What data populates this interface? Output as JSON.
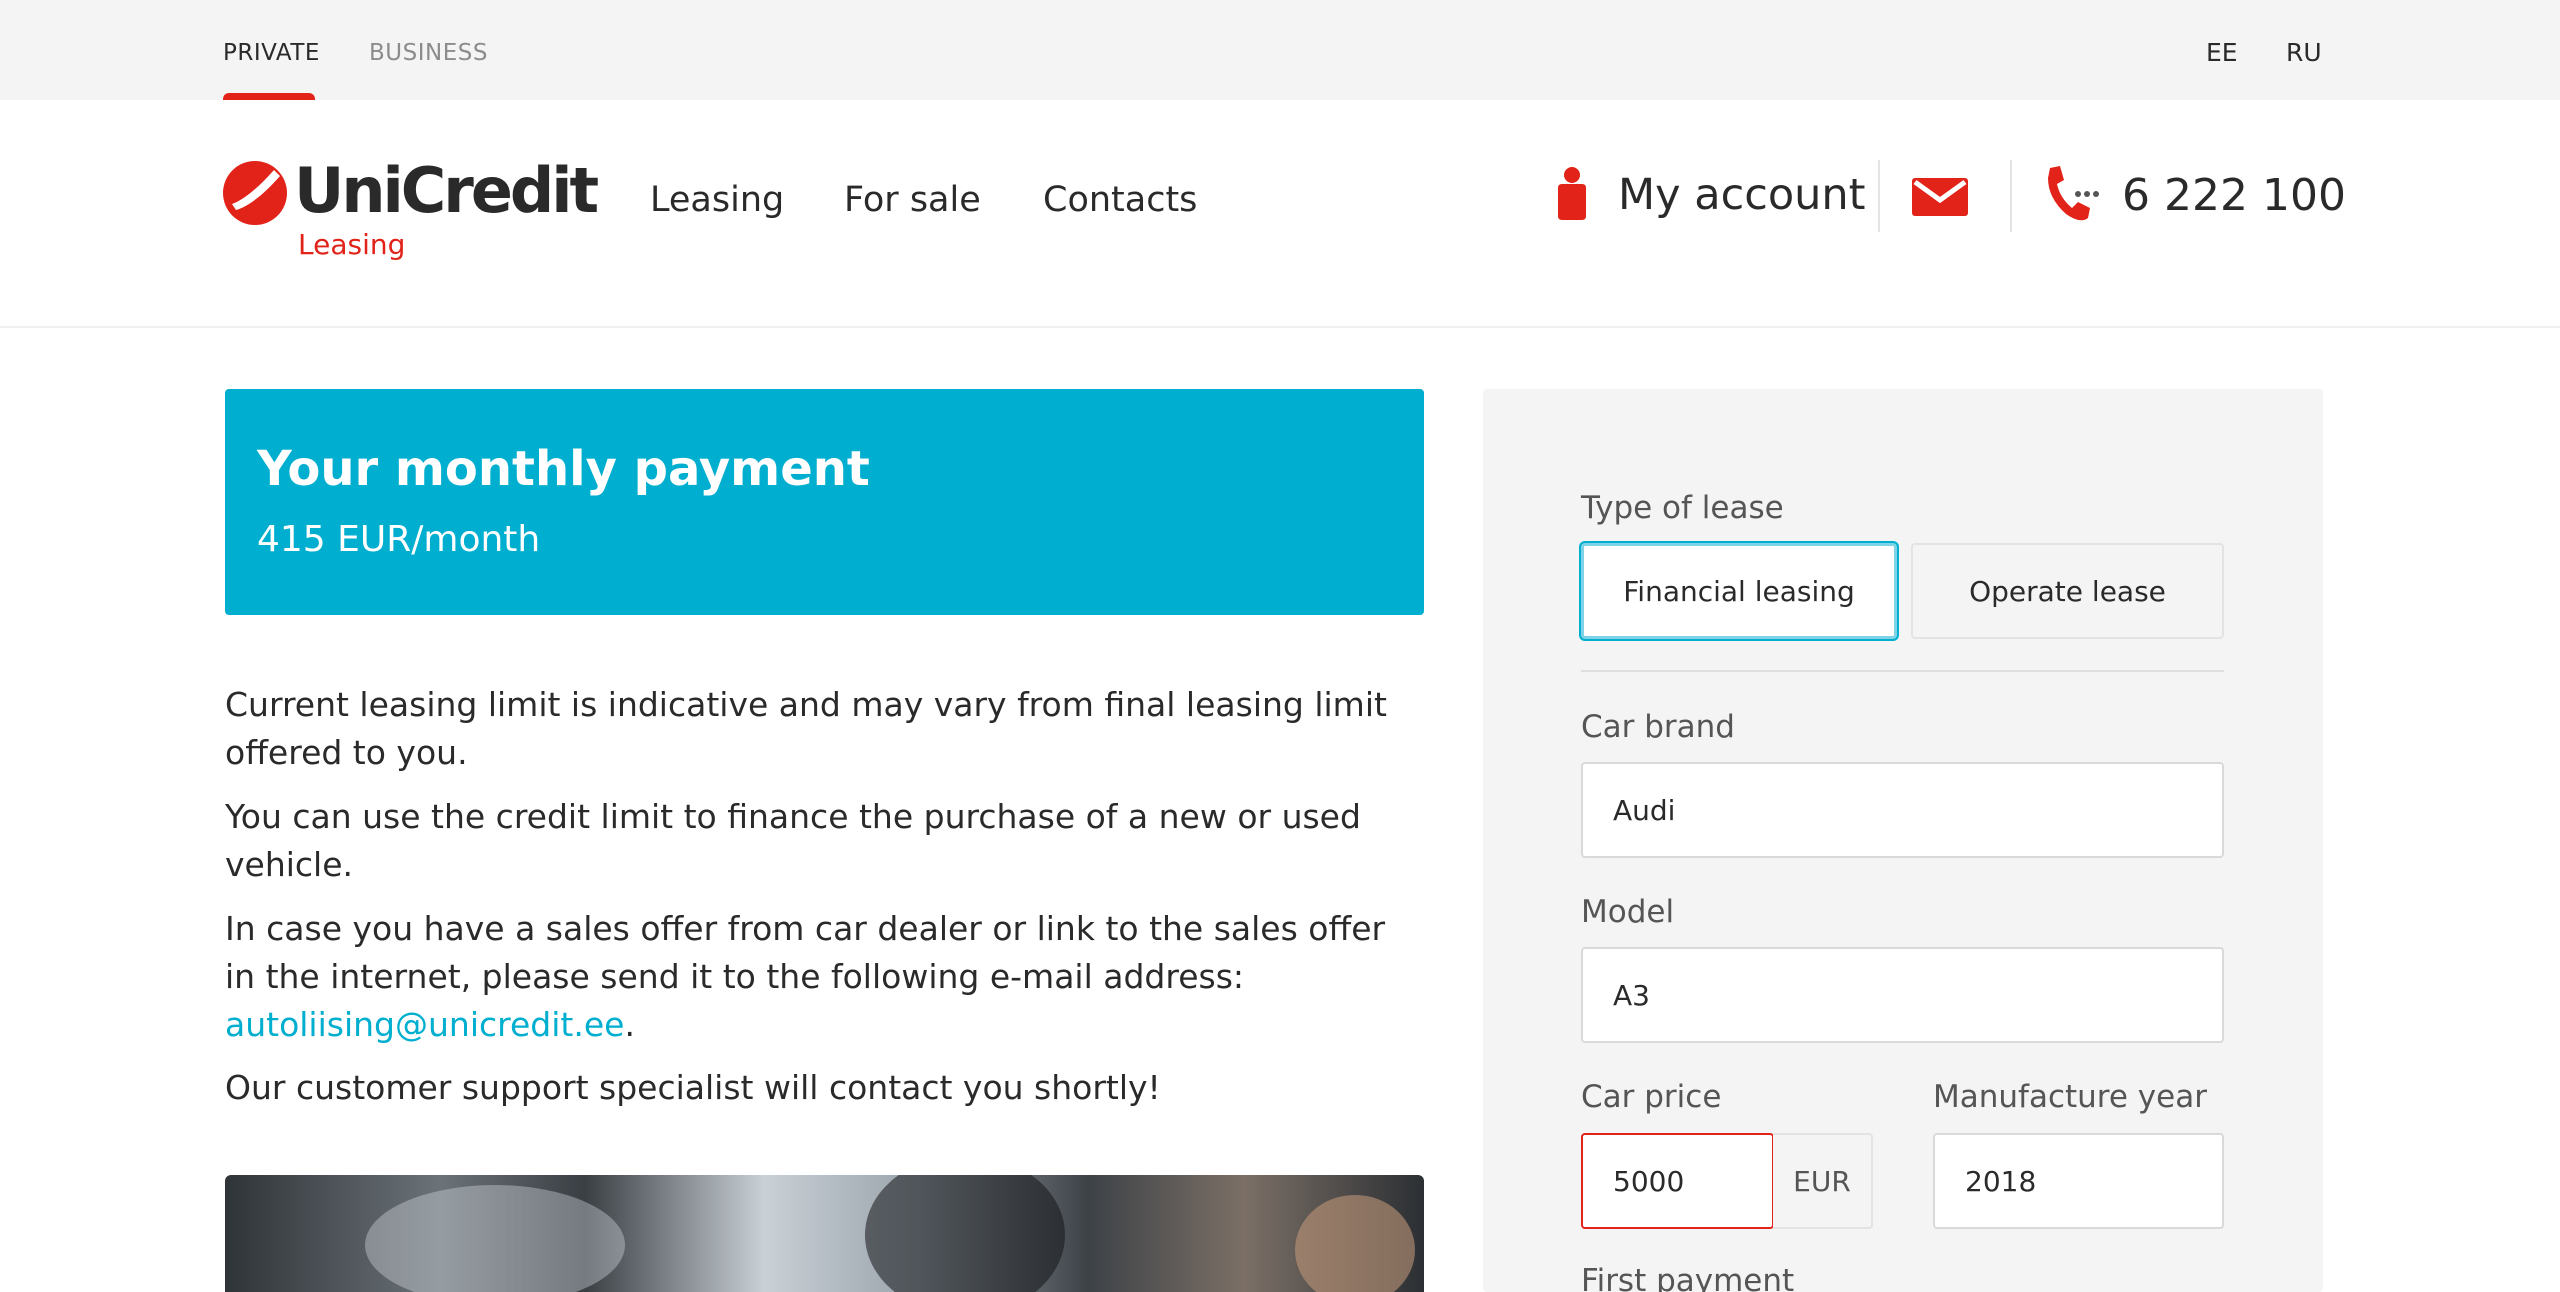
{
  "topbar": {
    "segments": [
      "PRIVATE",
      "BUSINESS"
    ],
    "languages": [
      "EE",
      "RU"
    ]
  },
  "header": {
    "logo_word": "UniCredit",
    "logo_sub": "Leasing",
    "nav": [
      "Leasing",
      "For sale",
      "Contacts"
    ],
    "account_label": "My account",
    "phone": "6 222 100"
  },
  "payment": {
    "title": "Your monthly payment",
    "value": "415 EUR/month"
  },
  "info": {
    "p1": "Current leasing limit is indicative and may vary from final leasing limit offered to you.",
    "p2": "You can use the credit limit to finance the purchase of a new or used vehicle.",
    "p3_text": "In case you have a sales offer from car dealer or link to the sales offer in the internet, please send it to the following e-mail address:",
    "p3_email": "autoliising@unicredit.ee",
    "p3_end": ".",
    "p4": "Our customer support specialist will contact you shortly!"
  },
  "form": {
    "lease_type_label": "Type of lease",
    "lease_types": [
      "Financial leasing",
      "Operate lease"
    ],
    "lease_type_selected": "Financial leasing",
    "brand_label": "Car brand",
    "brand_value": "Audi",
    "model_label": "Model",
    "model_value": "A3",
    "price_label": "Car price",
    "price_value": "5000",
    "price_unit": "EUR",
    "year_label": "Manufacture year",
    "year_value": "2018",
    "first_payment_label": "First payment"
  },
  "colors": {
    "brand_red": "#e2231a",
    "accent_cyan": "#00aecf",
    "panel_gray": "#f4f4f4"
  },
  "icons": [
    "unicredit-logo-icon",
    "user-icon",
    "mail-icon",
    "phone-icon"
  ]
}
